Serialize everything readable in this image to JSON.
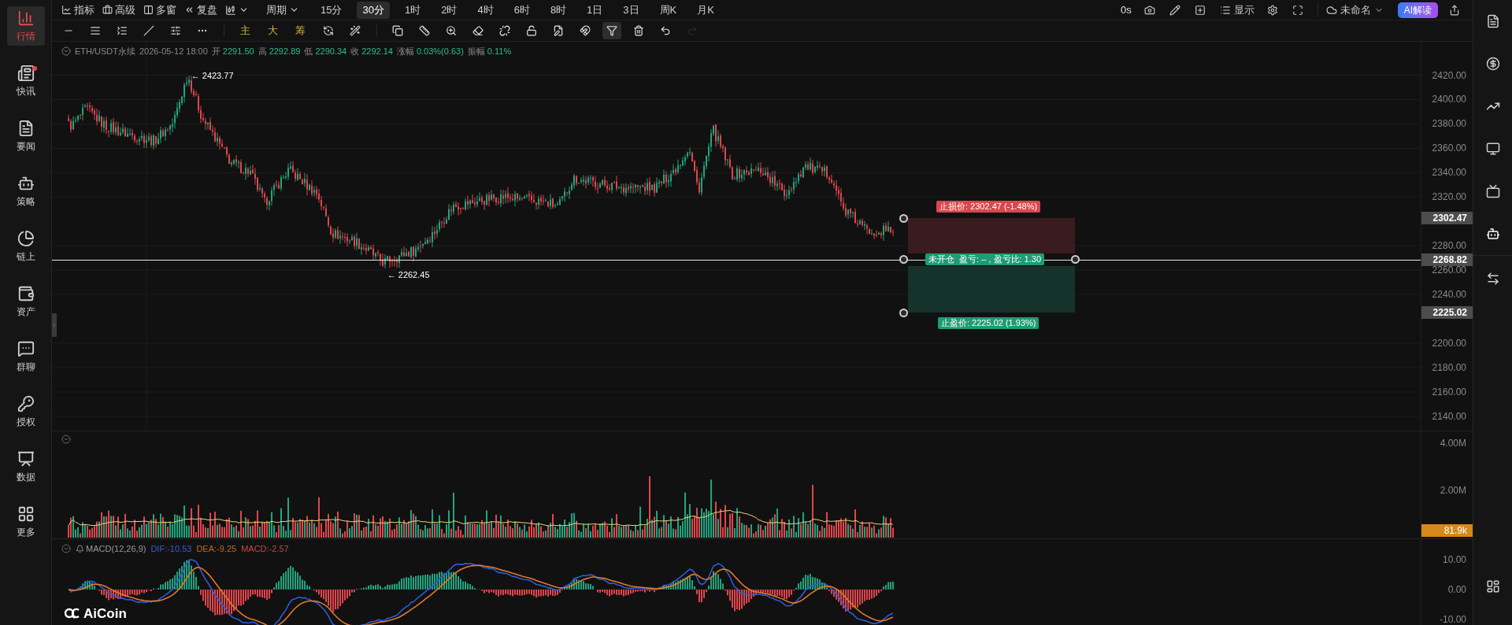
{
  "sidebar": {
    "items": [
      {
        "label": "行情",
        "selected": true,
        "badge": false
      },
      {
        "label": "快讯",
        "selected": false,
        "badge": true
      },
      {
        "label": "要闻",
        "selected": false,
        "badge": false
      },
      {
        "label": "策略",
        "selected": false,
        "badge": false
      },
      {
        "label": "链上",
        "selected": false,
        "badge": false
      },
      {
        "label": "资产",
        "selected": false,
        "badge": false
      },
      {
        "label": "群聊",
        "selected": false,
        "badge": false
      },
      {
        "label": "授权",
        "selected": false,
        "badge": false
      },
      {
        "label": "数据",
        "selected": false,
        "badge": false
      },
      {
        "label": "更多",
        "selected": false,
        "badge": false
      }
    ]
  },
  "top_bar": {
    "menus": [
      "指标",
      "高级",
      "多窗",
      "复盘"
    ],
    "period_label": "周期",
    "intervals": [
      {
        "label": "15分",
        "selected": false
      },
      {
        "label": "30分",
        "selected": true
      },
      {
        "label": "1时",
        "selected": false
      },
      {
        "label": "2时",
        "selected": false
      },
      {
        "label": "4时",
        "selected": false
      },
      {
        "label": "6时",
        "selected": false
      },
      {
        "label": "8时",
        "selected": false
      },
      {
        "label": "1日",
        "selected": false
      },
      {
        "label": "3日",
        "selected": false
      },
      {
        "label": "周K",
        "selected": false
      },
      {
        "label": "月K",
        "selected": false
      }
    ],
    "countdown": "0s",
    "display_label": "显示",
    "layout_name": "未命名",
    "ai_button": "AI解读"
  },
  "drawing_toolbar": {
    "text_tools": [
      "主",
      "大",
      "筹"
    ],
    "tools": [
      {
        "selected": false,
        "disabled": false
      },
      {
        "selected": false,
        "disabled": false
      },
      {
        "selected": false,
        "disabled": false
      },
      {
        "selected": false,
        "disabled": false
      },
      {
        "selected": false,
        "disabled": false
      },
      {
        "selected": false,
        "disabled": false
      },
      {
        "selected": false,
        "disabled": false
      },
      {
        "selected": false,
        "disabled": false
      },
      {
        "selected": true,
        "disabled": false
      },
      {
        "selected": false,
        "disabled": false
      },
      {
        "selected": false,
        "disabled": false
      },
      {
        "selected": false,
        "disabled": true
      }
    ]
  },
  "info_line": {
    "symbol": "ETH/USDT永续",
    "time": "2026-05-12 18:00",
    "fields": [
      {
        "label": "开",
        "value": "2291.50"
      },
      {
        "label": "高",
        "value": "2292.89"
      },
      {
        "label": "低",
        "value": "2290.34"
      },
      {
        "label": "收",
        "value": "2292.14"
      },
      {
        "label": "涨幅",
        "value": "0.03%(0.63)"
      },
      {
        "label": "振幅",
        "value": "0.11%"
      }
    ]
  },
  "main_chart": {
    "high_label": "← 2423.77",
    "low_label": "← 2262.45",
    "price_axis": [
      "2420.00",
      "2400.00",
      "2380.00",
      "2360.00",
      "2340.00",
      "2320.00",
      "2280.00",
      "2260.00",
      "2240.00",
      "2200.00",
      "2180.00",
      "2160.00",
      "2140.00"
    ],
    "price_tags": [
      "2302.47",
      "2268.82",
      "2225.02"
    ],
    "position": {
      "stop_loss": "止损价: 2302.47 (-1.48%)",
      "status": "未开仓  盈亏: – , 盈亏比: 1.30",
      "take_profit": "止盈价: 2225.02 (1.93%)"
    }
  },
  "volume": {
    "axis": [
      "4.00M",
      "2.00M"
    ],
    "current_tag": "81.9k"
  },
  "macd": {
    "title": "MACD(12,26,9)",
    "dif": "DIF:-10.53",
    "dea": "DEA:-9.25",
    "macd": "MACD:-2.57",
    "axis": [
      "10.00",
      "0.00",
      "-10.00"
    ],
    "logo": "AiCoin"
  }
}
